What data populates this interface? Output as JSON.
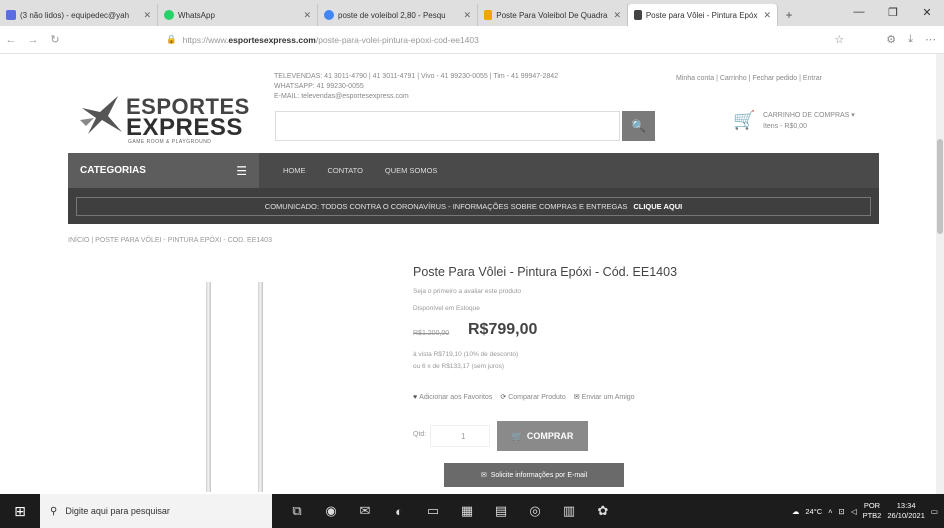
{
  "browser": {
    "tabs": [
      {
        "title": "(3 não lidos) - equipedec@yah",
        "color": "#5b6ee1"
      },
      {
        "title": "WhatsApp",
        "color": "#25d366"
      },
      {
        "title": "poste de voleibol 2,80 - Pesqu",
        "color": "#4285f4"
      },
      {
        "title": "Poste Para Voleibol De Quadra",
        "color": "#f0a500"
      },
      {
        "title": "Poste para Vôlei - Pintura Epóx",
        "color": "#444444"
      }
    ],
    "url_prefix": "https://www.",
    "url_host": "esportesexpress.com",
    "url_path": "/poste-para-volei-pintura-epoxi-cod-ee1403"
  },
  "header": {
    "contact_line1": "TELEVENDAS: 41 3011-4790 | 41 3011-4791 | Vivo - 41 99230-0055 | Tim - 41 99947-2842",
    "contact_line2": "WHATSAPP: 41 99230-0055",
    "contact_line3": "E-MAIL: televendas@esportesexpress.com",
    "top_links": "Minha conta | Carrinho | Fechar pedido | Entrar",
    "logo_line1": "ESPORTES",
    "logo_line2": "EXPRESS",
    "logo_sub": "GAME ROOM & PLAYGROUND",
    "cart_title": "CARRINHO DE COMPRAS ▾",
    "cart_items": "Itens - R$0,00"
  },
  "nav": {
    "categories_label": "CATEGORIAS",
    "items": [
      "HOME",
      "CONTATO",
      "QUEM SOMOS"
    ],
    "promo_text": "COMUNICADO: TODOS CONTRA O CORONAVÍRUS - INFORMAÇÕES SOBRE COMPRAS E ENTREGAS",
    "promo_cta": "CLIQUE AQUI"
  },
  "breadcrumb": "INÍCIO | POSTE PARA VÔLEI - PINTURA EPÓXI - COD. EE1403",
  "product": {
    "name": "Poste Para Vôlei - Pintura Epóxi - Cód. EE1403",
    "review_text": "Seja o primeiro a avaliar este produto",
    "availability": "Disponível em Estoque",
    "old_price": "R$1.200,00",
    "price": "R$799,00",
    "cash_price": "à vista R$719,10 (10% de desconto)",
    "installments": "ou 6 x de R$133,17 (sem juros)",
    "action_wishlist": "Adicionar aos Favoritos",
    "action_compare": "Comparar Produto",
    "action_share": "Enviar um Amigo",
    "qty_label": "Qtd:",
    "qty_value": "1",
    "buy_label": "COMPRAR",
    "email_label": "Solicite informações por E-mail"
  },
  "taskbar": {
    "search_placeholder": "Digite aqui para pesquisar",
    "weather": "24°C",
    "lang": "POR",
    "lang2": "PTB2",
    "time": "13:34",
    "date": "26/10/2021"
  }
}
